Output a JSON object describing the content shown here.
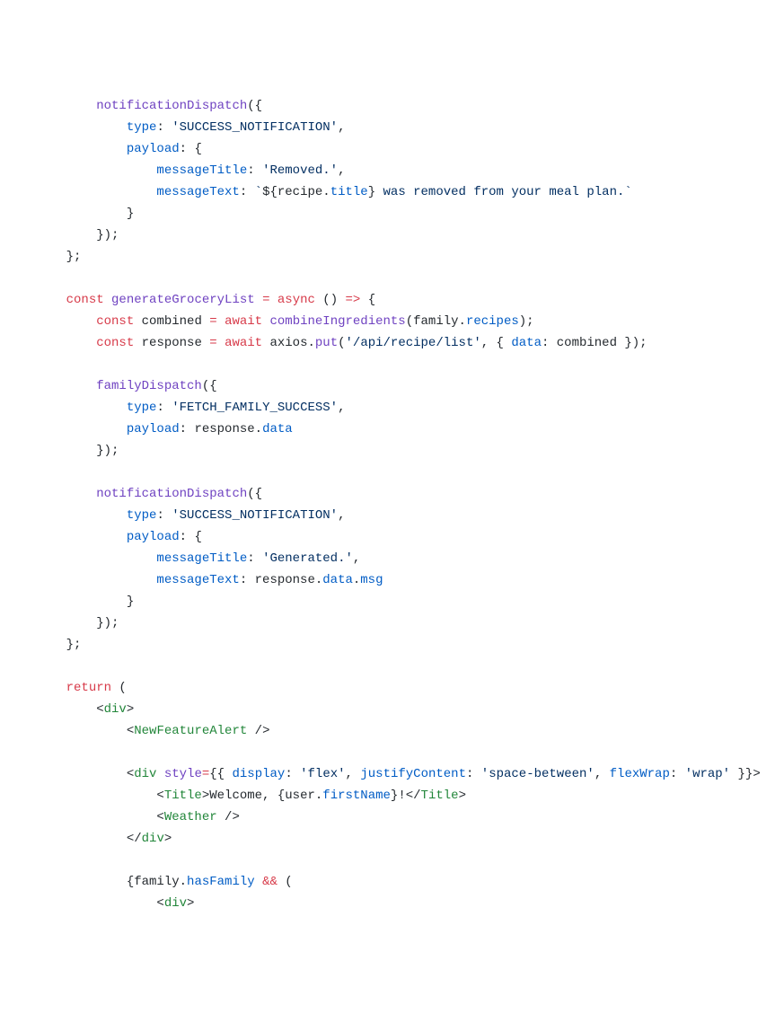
{
  "code": {
    "t1": "        ",
    "t2": "notificationDispatch",
    "t3": "({",
    "t4": "            ",
    "t5": "type",
    "t6": ": ",
    "t7": "'SUCCESS_NOTIFICATION'",
    "t8": ",",
    "t9": "            ",
    "t10": "payload",
    "t11": ": {",
    "t12": "                ",
    "t13": "messageTitle",
    "t14": ": ",
    "t15": "'Removed.'",
    "t16": ",",
    "t17": "                ",
    "t18": "messageText",
    "t19": ": ",
    "t20": "`",
    "t21": "${",
    "t22": "recipe",
    "t23": ".",
    "t24": "title",
    "t25": "}",
    "t26": " was removed from your meal plan.",
    "t27": "`",
    "t28": "            }",
    "t29": "        });",
    "t30": "    };",
    "t31": "",
    "t32": "    ",
    "t33": "const",
    "t34": " ",
    "t35": "generateGroceryList",
    "t36": " ",
    "t37": "=",
    "t38": " ",
    "t39": "async",
    "t40": " () ",
    "t41": "=>",
    "t42": " {",
    "t43": "        ",
    "t44": "const",
    "t45": " combined ",
    "t46": "=",
    "t47": " ",
    "t48": "await",
    "t49": " ",
    "t50": "combineIngredients",
    "t51": "(family.",
    "t52": "recipes",
    "t53": ");",
    "t54": "        ",
    "t55": "const",
    "t56": " response ",
    "t57": "=",
    "t58": " ",
    "t59": "await",
    "t60": " axios.",
    "t61": "put",
    "t62": "(",
    "t63": "'/api/recipe/list'",
    "t64": ", { ",
    "t65": "data",
    "t66": ": combined });",
    "t67": "",
    "t68": "        ",
    "t69": "familyDispatch",
    "t70": "({",
    "t71": "            ",
    "t72": "type",
    "t73": ": ",
    "t74": "'FETCH_FAMILY_SUCCESS'",
    "t75": ",",
    "t76": "            ",
    "t77": "payload",
    "t78": ": response.",
    "t79": "data",
    "t80": "        });",
    "t81": "",
    "t82": "        ",
    "t83": "notificationDispatch",
    "t84": "({",
    "t85": "            ",
    "t86": "type",
    "t87": ": ",
    "t88": "'SUCCESS_NOTIFICATION'",
    "t89": ",",
    "t90": "            ",
    "t91": "payload",
    "t92": ": {",
    "t93": "                ",
    "t94": "messageTitle",
    "t95": ": ",
    "t96": "'Generated.'",
    "t97": ",",
    "t98": "                ",
    "t99": "messageText",
    "t100": ": response.",
    "t101": "data",
    "t102": ".",
    "t103": "msg",
    "t104": "            }",
    "t105": "        });",
    "t106": "    };",
    "t107": "",
    "t108": "    ",
    "t109": "return",
    "t110": " (",
    "t111": "        ",
    "t112": "<",
    "t113": "div",
    "t114": ">",
    "t115": "            ",
    "t116": "<",
    "t117": "NewFeatureAlert",
    "t118": " />",
    "t119": "",
    "t120": "            ",
    "t121": "<",
    "t122": "div",
    "t123": " ",
    "t124": "style",
    "t125": "=",
    "t126": "{{ ",
    "t127": "display",
    "t128": ": ",
    "t129": "'flex'",
    "t130": ", ",
    "t131": "justifyContent",
    "t132": ": ",
    "t133": "'space-between'",
    "t134": ", ",
    "t135": "flexWrap",
    "t136": ": ",
    "t137": "'wrap'",
    "t138": " }}",
    "t139": ">",
    "t140": "                ",
    "t141": "<",
    "t142": "Title",
    "t143": ">",
    "t144": "Welcome, ",
    "t145": "{user.",
    "t146": "firstName",
    "t147": "}",
    "t148": "!",
    "t149": "</",
    "t150": "Title",
    "t151": ">",
    "t152": "                ",
    "t153": "<",
    "t154": "Weather",
    "t155": " />",
    "t156": "            ",
    "t157": "</",
    "t158": "div",
    "t159": ">",
    "t160": "",
    "t161": "            ",
    "t162": "{family.",
    "t163": "hasFamily",
    "t164": " ",
    "t165": "&&",
    "t166": " (",
    "t167": "                ",
    "t168": "<",
    "t169": "div",
    "t170": ">"
  }
}
